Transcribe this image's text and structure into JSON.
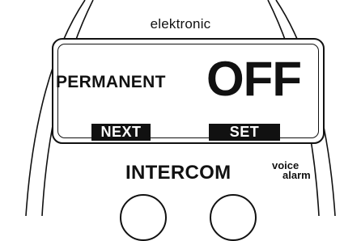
{
  "device": {
    "brand": "elektronic",
    "display": {
      "mode_label": "PERMANENT",
      "mode_value": "OFF",
      "softkeys": {
        "left": "NEXT",
        "right": "SET"
      }
    },
    "product_name": "INTERCOM",
    "product_tag_line1": "voice",
    "product_tag_line2": "alarm",
    "colors": {
      "ink": "#111111",
      "background": "#ffffff"
    }
  }
}
